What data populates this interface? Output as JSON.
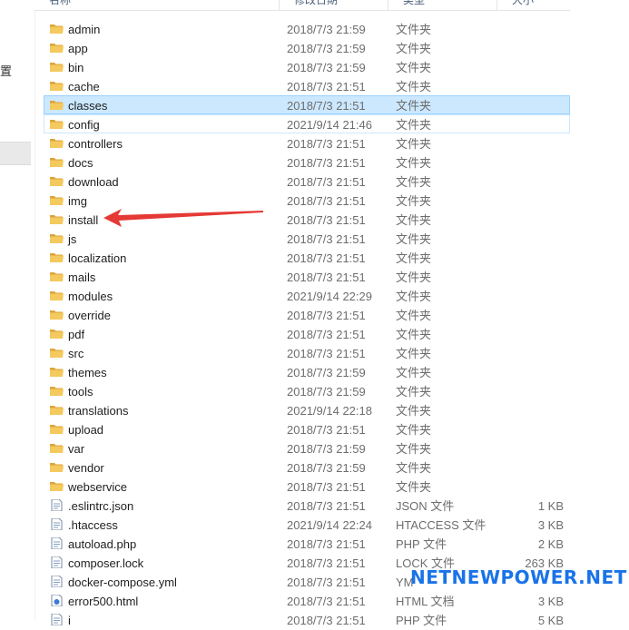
{
  "sidebar": {
    "pinned_label": "置"
  },
  "columns": {
    "name": "名称",
    "date": "修改日期",
    "type": "类型",
    "size": "大小"
  },
  "colors": {
    "selection": "#cce8ff",
    "selection_border": "#99d1ff",
    "folder": "#e8b94a",
    "arrow": "#e53935",
    "watermark": "#1a73e8"
  },
  "files": [
    {
      "name": "admin",
      "date": "2018/7/3 21:59",
      "type": "文件夹",
      "size": "",
      "icon": "folder-icon"
    },
    {
      "name": "app",
      "date": "2018/7/3 21:59",
      "type": "文件夹",
      "size": "",
      "icon": "folder-icon"
    },
    {
      "name": "bin",
      "date": "2018/7/3 21:59",
      "type": "文件夹",
      "size": "",
      "icon": "folder-icon"
    },
    {
      "name": "cache",
      "date": "2018/7/3 21:51",
      "type": "文件夹",
      "size": "",
      "icon": "folder-icon"
    },
    {
      "name": "classes",
      "date": "2018/7/3 21:51",
      "type": "文件夹",
      "size": "",
      "icon": "folder-icon",
      "state": "selected"
    },
    {
      "name": "config",
      "date": "2021/9/14 21:46",
      "type": "文件夹",
      "size": "",
      "icon": "folder-icon",
      "state": "hover"
    },
    {
      "name": "controllers",
      "date": "2018/7/3 21:51",
      "type": "文件夹",
      "size": "",
      "icon": "folder-icon"
    },
    {
      "name": "docs",
      "date": "2018/7/3 21:51",
      "type": "文件夹",
      "size": "",
      "icon": "folder-icon"
    },
    {
      "name": "download",
      "date": "2018/7/3 21:51",
      "type": "文件夹",
      "size": "",
      "icon": "folder-icon"
    },
    {
      "name": "img",
      "date": "2018/7/3 21:51",
      "type": "文件夹",
      "size": "",
      "icon": "folder-icon"
    },
    {
      "name": "install",
      "date": "2018/7/3 21:51",
      "type": "文件夹",
      "size": "",
      "icon": "folder-icon"
    },
    {
      "name": "js",
      "date": "2018/7/3 21:51",
      "type": "文件夹",
      "size": "",
      "icon": "folder-icon"
    },
    {
      "name": "localization",
      "date": "2018/7/3 21:51",
      "type": "文件夹",
      "size": "",
      "icon": "folder-icon"
    },
    {
      "name": "mails",
      "date": "2018/7/3 21:51",
      "type": "文件夹",
      "size": "",
      "icon": "folder-icon"
    },
    {
      "name": "modules",
      "date": "2021/9/14 22:29",
      "type": "文件夹",
      "size": "",
      "icon": "folder-icon"
    },
    {
      "name": "override",
      "date": "2018/7/3 21:51",
      "type": "文件夹",
      "size": "",
      "icon": "folder-icon"
    },
    {
      "name": "pdf",
      "date": "2018/7/3 21:51",
      "type": "文件夹",
      "size": "",
      "icon": "folder-icon"
    },
    {
      "name": "src",
      "date": "2018/7/3 21:51",
      "type": "文件夹",
      "size": "",
      "icon": "folder-icon"
    },
    {
      "name": "themes",
      "date": "2018/7/3 21:59",
      "type": "文件夹",
      "size": "",
      "icon": "folder-icon"
    },
    {
      "name": "tools",
      "date": "2018/7/3 21:59",
      "type": "文件夹",
      "size": "",
      "icon": "folder-icon"
    },
    {
      "name": "translations",
      "date": "2021/9/14 22:18",
      "type": "文件夹",
      "size": "",
      "icon": "folder-icon"
    },
    {
      "name": "upload",
      "date": "2018/7/3 21:51",
      "type": "文件夹",
      "size": "",
      "icon": "folder-icon"
    },
    {
      "name": "var",
      "date": "2018/7/3 21:59",
      "type": "文件夹",
      "size": "",
      "icon": "folder-icon"
    },
    {
      "name": "vendor",
      "date": "2018/7/3 21:59",
      "type": "文件夹",
      "size": "",
      "icon": "folder-icon"
    },
    {
      "name": "webservice",
      "date": "2018/7/3 21:51",
      "type": "文件夹",
      "size": "",
      "icon": "folder-icon"
    },
    {
      "name": ".eslintrc.json",
      "date": "2018/7/3 21:51",
      "type": "JSON 文件",
      "size": "1 KB",
      "icon": "file-icon"
    },
    {
      "name": ".htaccess",
      "date": "2021/9/14 22:24",
      "type": "HTACCESS 文件",
      "size": "3 KB",
      "icon": "file-icon"
    },
    {
      "name": "autoload.php",
      "date": "2018/7/3 21:51",
      "type": "PHP 文件",
      "size": "2 KB",
      "icon": "file-icon"
    },
    {
      "name": "composer.lock",
      "date": "2018/7/3 21:51",
      "type": "LOCK 文件",
      "size": "263 KB",
      "icon": "file-icon"
    },
    {
      "name": "docker-compose.yml",
      "date": "2018/7/3 21:51",
      "type": "YM",
      "size": "",
      "icon": "file-icon"
    },
    {
      "name": "error500.html",
      "date": "2018/7/3 21:51",
      "type": "HTML 文档",
      "size": "3 KB",
      "icon": "html-file-icon"
    },
    {
      "name": "i",
      "date": "2018/7/3 21:51",
      "type": "PHP 文件",
      "size": "5 KB",
      "icon": "file-icon"
    }
  ],
  "watermark": "NETNEWPOWER.NET"
}
